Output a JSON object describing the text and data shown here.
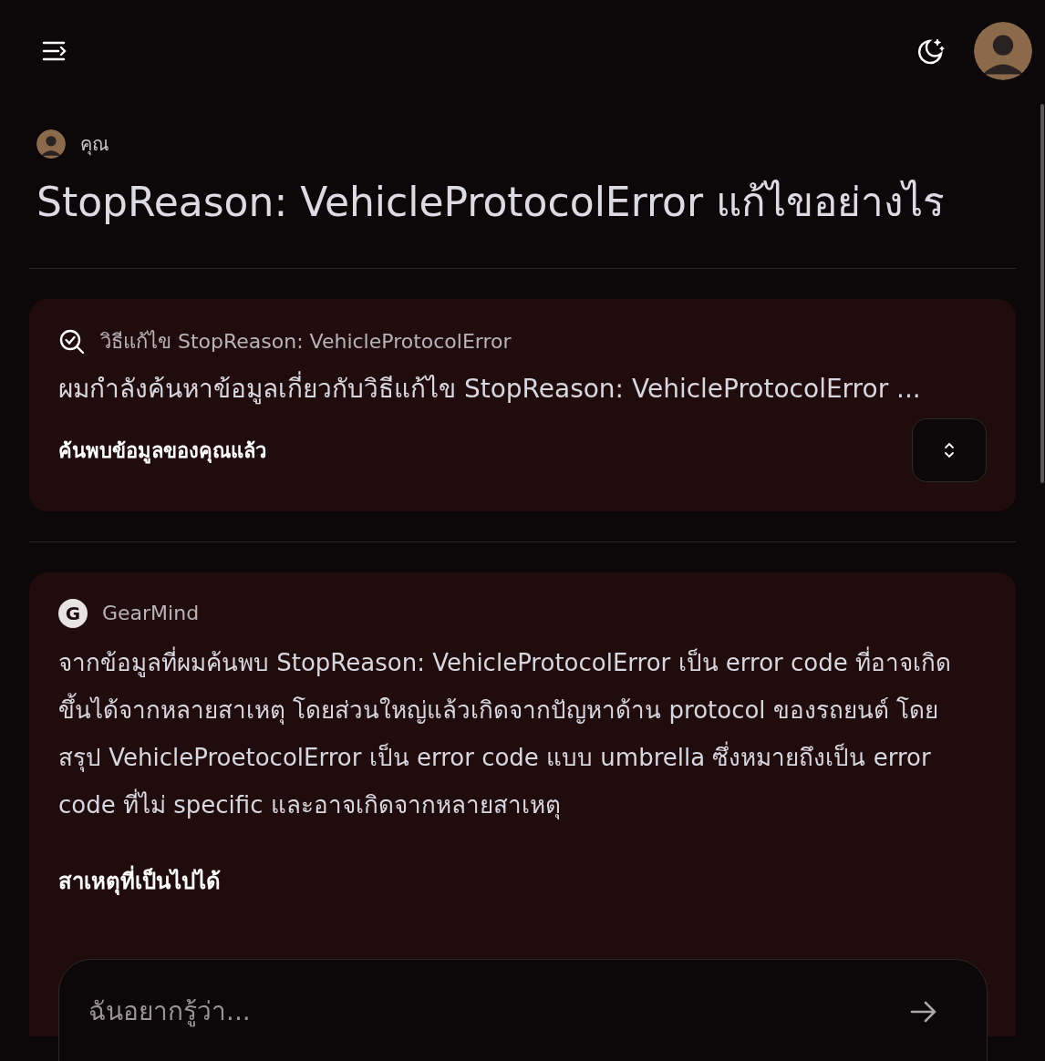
{
  "user_message": {
    "author": "คุณ",
    "text": "StopReason: VehicleProtocolError แก้ไขอย่างไร"
  },
  "search_card": {
    "title": "วิธีแก้ไข StopReason: VehicleProtocolError",
    "summary": "ผมกำลังค้นหาข้อมูลเกี่ยวกับวิธีแก้ไข StopReason: VehicleProtocolError ...",
    "status": "ค้นพบข้อมูลของคุณแล้ว",
    "expanded": false
  },
  "answer": {
    "author": "GearMind",
    "logo": "G",
    "paragraph": "จากข้อมูลที่ผมค้นพบ StopReason: VehicleProtocolError เป็น error code ที่อาจเกิดขึ้นได้จากหลายสาเหตุ โดยส่วนใหญ่แล้วเกิดจากปัญหาด้าน protocol ของรถยนต์ โดยสรุป VehicleProetocolError เป็น error code แบบ umbrella ซึ่งหมายถึงเป็น error code ที่ไม่ specific และอาจเกิดจากหลายสาเหตุ",
    "heading": "สาเหตุที่เป็นไปได้"
  },
  "composer": {
    "placeholder": "ฉันอยากรู้ว่า..."
  }
}
